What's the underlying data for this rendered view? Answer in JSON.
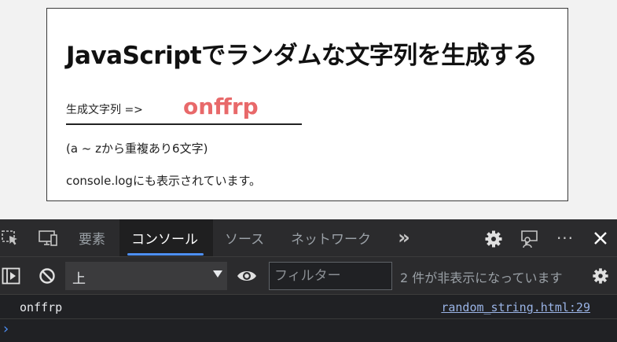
{
  "page": {
    "title": "JavaScriptでランダムな文字列を生成する",
    "result_label": "生成文字列 =>",
    "result_value": "onffrp",
    "note_range": "(a ~ zから重複あり6文字)",
    "note_console": "console.logにも表示されています。",
    "accent_color": "#e8696a"
  },
  "devtools": {
    "icons": [
      "inspect-element-icon",
      "device-toolbar-icon",
      "more-tabs-icon",
      "settings-icon",
      "feedback-icon",
      "more-options-icon",
      "close-icon",
      "sidebar-toggle-icon",
      "clear-console-icon",
      "live-expression-icon",
      "console-settings-icon"
    ],
    "tabs": [
      {
        "label": "要素",
        "active": false
      },
      {
        "label": "コンソール",
        "active": true
      },
      {
        "label": "ソース",
        "active": false
      },
      {
        "label": "ネットワーク",
        "active": false
      }
    ],
    "more_tabs": "»",
    "more_options": "···",
    "toolbar": {
      "context": "上",
      "filter_placeholder": "フィルター",
      "hidden_count": "2 件が非表示になっています"
    },
    "log": {
      "message": "onffrp",
      "source": "random_string.html:29"
    },
    "prompt": "›",
    "accent_color": "#4d8ff5"
  }
}
